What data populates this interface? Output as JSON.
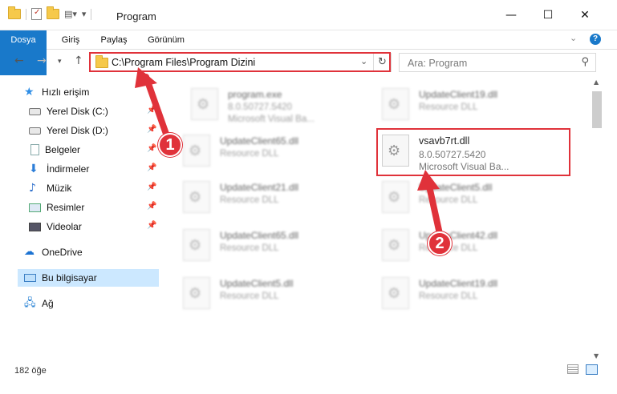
{
  "window": {
    "title": "Program",
    "minimize_icon": "minimize-icon",
    "maximize_icon": "maximize-icon",
    "close_icon": "close-icon"
  },
  "ribbon": {
    "tabs": [
      "Dosya",
      "Giriş",
      "Paylaş",
      "Görünüm"
    ],
    "accent": "#1979ca"
  },
  "address": {
    "path": "C:\\Program Files\\Program Dizini"
  },
  "search": {
    "placeholder": "Ara: Program"
  },
  "sidebar": {
    "items": [
      {
        "label": "Hızlı erişim",
        "icon": "star-icon"
      },
      {
        "label": "Yerel Disk (C:)",
        "icon": "disk-icon",
        "pinned": true
      },
      {
        "label": "Yerel Disk (D:)",
        "icon": "disk-icon",
        "pinned": true
      },
      {
        "label": "Belgeler",
        "icon": "document-icon",
        "pinned": true
      },
      {
        "label": "İndirmeler",
        "icon": "download-icon",
        "pinned": true
      },
      {
        "label": "Müzik",
        "icon": "music-icon",
        "pinned": true
      },
      {
        "label": "Resimler",
        "icon": "picture-icon",
        "pinned": true
      },
      {
        "label": "Videolar",
        "icon": "video-icon",
        "pinned": true
      },
      {
        "label": "OneDrive",
        "icon": "cloud-icon"
      },
      {
        "label": "Bu bilgisayar",
        "icon": "computer-icon",
        "selected": true
      },
      {
        "label": "Ağ",
        "icon": "network-icon"
      }
    ]
  },
  "files": [
    {
      "name": "program.exe",
      "line2": "8.0.50727.5420",
      "line3": "Microsoft Visual Ba..."
    },
    {
      "name": "UpdateClient19.dll",
      "line2": "Resource DLL",
      "line3": ""
    },
    {
      "name": "UpdateClient65.dll",
      "line2": "Resource DLL",
      "line3": ""
    },
    {
      "name": "vsavb7rt.dll",
      "line2": "8.0.50727.5420",
      "line3": "Microsoft Visual Ba..."
    },
    {
      "name": "UpdateClient21.dll",
      "line2": "Resource DLL",
      "line3": ""
    },
    {
      "name": "UpdateClient5.dll",
      "line2": "Resource DLL",
      "line3": ""
    },
    {
      "name": "UpdateClient65.dll",
      "line2": "Resource DLL",
      "line3": ""
    },
    {
      "name": "UpdateClient42.dll",
      "line2": "Resource DLL",
      "line3": ""
    },
    {
      "name": "UpdateClient5.dll",
      "line2": "Resource DLL",
      "line3": ""
    },
    {
      "name": "UpdateClient19.dll",
      "line2": "Resource DLL",
      "line3": ""
    }
  ],
  "status": {
    "count": "182 öğe"
  },
  "annotations": {
    "marker1": "1",
    "marker2": "2",
    "highlight_color": "#e0323a"
  }
}
